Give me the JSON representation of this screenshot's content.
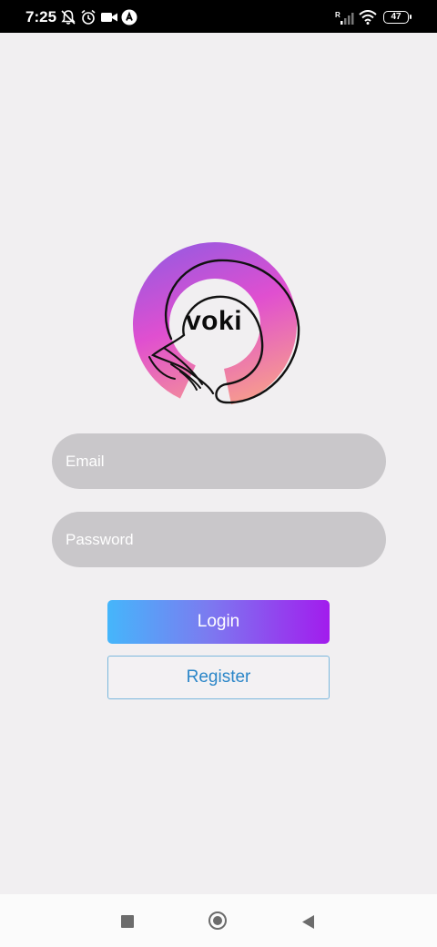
{
  "status_bar": {
    "time": "7:25",
    "signal_badge": "R",
    "battery": "47",
    "icons": [
      "notifications-off-icon",
      "alarm-icon",
      "video-camera-icon",
      "app-notification-icon",
      "signal-icon",
      "wifi-icon",
      "battery-icon"
    ]
  },
  "logo": {
    "text": "voki",
    "colors": {
      "gradient_start": "#9b59e0",
      "gradient_mid": "#e04fd0",
      "gradient_end": "#f8a08a"
    }
  },
  "form": {
    "email_placeholder": "Email",
    "password_placeholder": "Password"
  },
  "buttons": {
    "login_label": "Login",
    "register_label": "Register"
  },
  "colors": {
    "background": "#f1eff1",
    "field_bg": "#c9c7ca",
    "login_gradient": [
      "#45b6fb",
      "#a21ced"
    ],
    "register_text": "#2b86c8"
  },
  "nav_bar": {
    "icons": [
      "recent-apps-icon",
      "home-icon",
      "back-icon"
    ]
  }
}
